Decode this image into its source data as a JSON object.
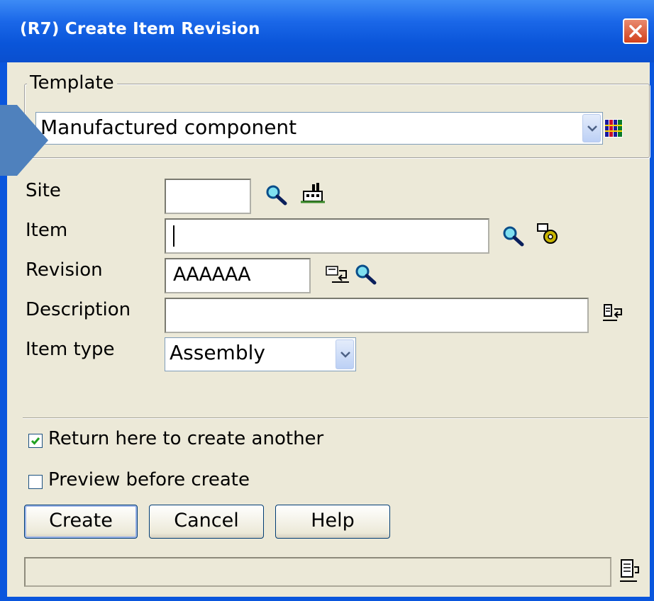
{
  "window": {
    "title": "(R7) Create Item Revision",
    "close_icon": "close-icon"
  },
  "template": {
    "group_label": "Template",
    "selected": "Manufactured component",
    "icon": "template-grid-icon"
  },
  "form": {
    "site": {
      "label": "Site",
      "value": ""
    },
    "item": {
      "label": "Item",
      "value": ""
    },
    "revision": {
      "label": "Revision",
      "value": "AAAAAA"
    },
    "description": {
      "label": "Description",
      "value": ""
    },
    "item_type": {
      "label": "Item type",
      "selected": "Assembly"
    }
  },
  "options": {
    "return_here": {
      "label": "Return here to create another",
      "checked": true
    },
    "preview": {
      "label": "Preview before create",
      "checked": false
    }
  },
  "buttons": {
    "create": "Create",
    "cancel": "Cancel",
    "help": "Help"
  },
  "status": {
    "text": ""
  },
  "colors": {
    "titlebar": "#0a55d9",
    "client": "#ece9d8",
    "accent": "#4f81bd"
  }
}
